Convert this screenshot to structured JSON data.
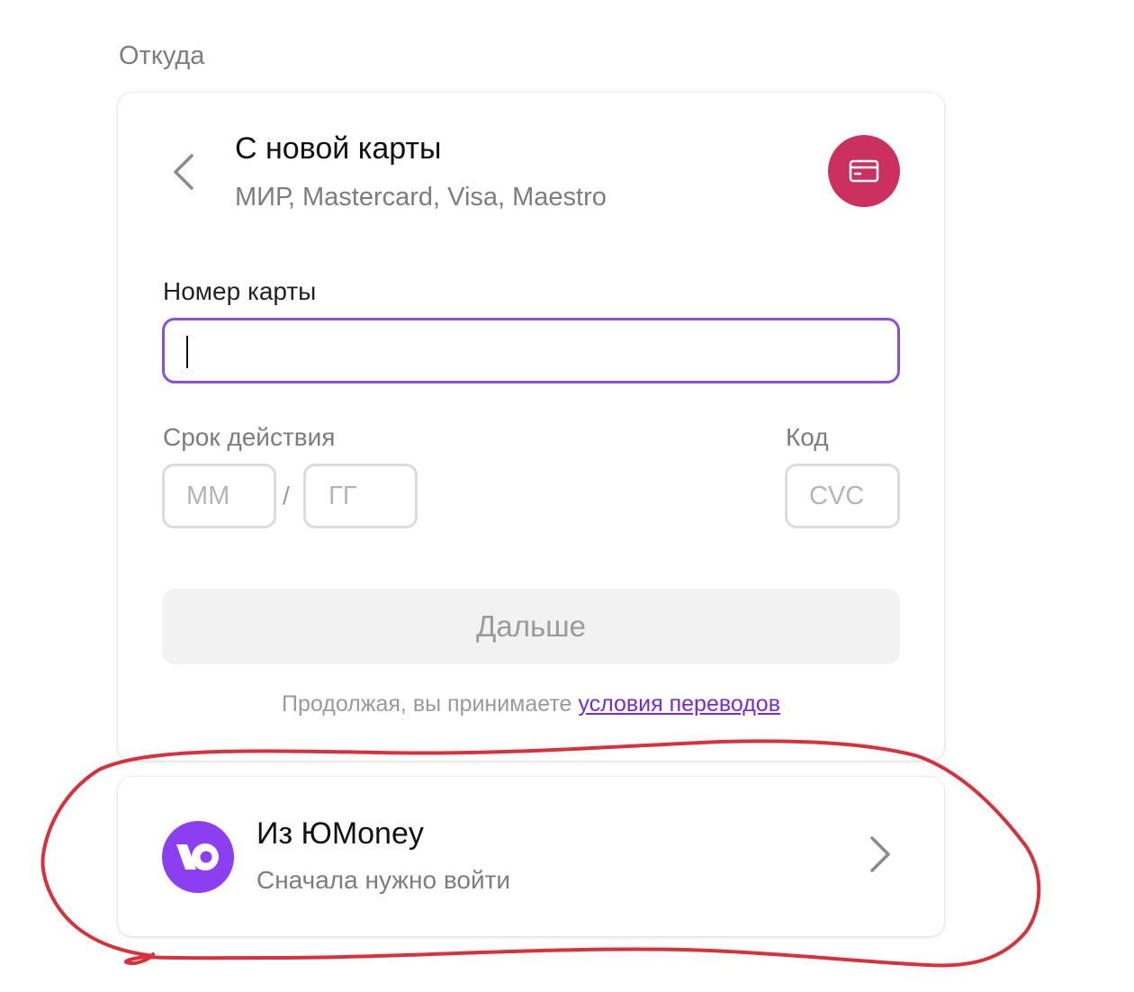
{
  "source": {
    "label": "Откуда"
  },
  "new_card": {
    "title": "С новой карты",
    "subtitle": "МИР, Mastercard, Visa, Maestro",
    "card_number_label": "Номер карты",
    "card_number_value": "",
    "expiry_label": "Срок действия",
    "month_placeholder": "ММ",
    "year_placeholder": "ГГ",
    "expiry_separator": "/",
    "code_label": "Код",
    "cvc_placeholder": "CVC",
    "next_button": "Дальше",
    "terms_text": "Продолжая, вы принимаете ",
    "terms_link": "условия переводов"
  },
  "yoomoney": {
    "title": "Из ЮMoney",
    "subtitle": "Сначала нужно войти"
  },
  "colors": {
    "card_icon_bg": "#cb3060",
    "input_focus_border": "#8b4fd9",
    "link": "#7b2ad1",
    "yoomoney_brand": "#8b3ff0",
    "annotation_stroke": "#d9303c"
  }
}
